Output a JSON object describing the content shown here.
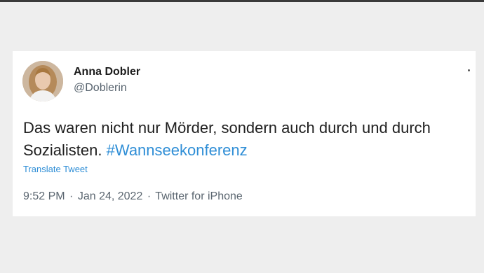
{
  "tweet": {
    "author": {
      "name": "Anna Dobler",
      "handle": "@Doblerin"
    },
    "text_main": "Das waren nicht nur Mörder, sondern auch durch und durch Sozialisten.",
    "hashtag": "#Wannseekonferenz",
    "translate_label": "Translate Tweet",
    "meta": {
      "time": "9:52 PM",
      "separator": "·",
      "date": "Jan 24, 2022",
      "source": "Twitter for iPhone"
    }
  },
  "colors": {
    "link": "#2f8ed6",
    "text": "#202020",
    "muted": "#5b6670",
    "card": "#ffffff",
    "background": "#eeeeee"
  },
  "icons": {
    "more": "more-options-icon"
  }
}
